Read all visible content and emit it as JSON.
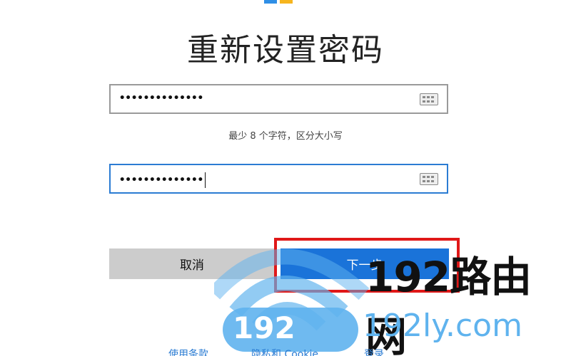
{
  "title": "重新设置密码",
  "password_field": {
    "value": "••••••••••••••"
  },
  "confirm_field": {
    "value": "••••••••••••••"
  },
  "hint": "最少 8 个字符，区分大小写",
  "buttons": {
    "cancel": "取消",
    "next": "下一步"
  },
  "footer": {
    "terms": "使用条款",
    "privacy": "隐私和 Cookie",
    "signin": "登录"
  },
  "watermark": {
    "brand": "192路由网",
    "site": "192ly.com",
    "badge": "192"
  },
  "colors": {
    "accent": "#1a73d9",
    "highlight": "#e01818",
    "cancel_bg": "#cccccc",
    "watermark": "#5fb3ee"
  },
  "icons": {
    "keyboard": "keyboard-icon",
    "wifi": "wifi-icon"
  }
}
